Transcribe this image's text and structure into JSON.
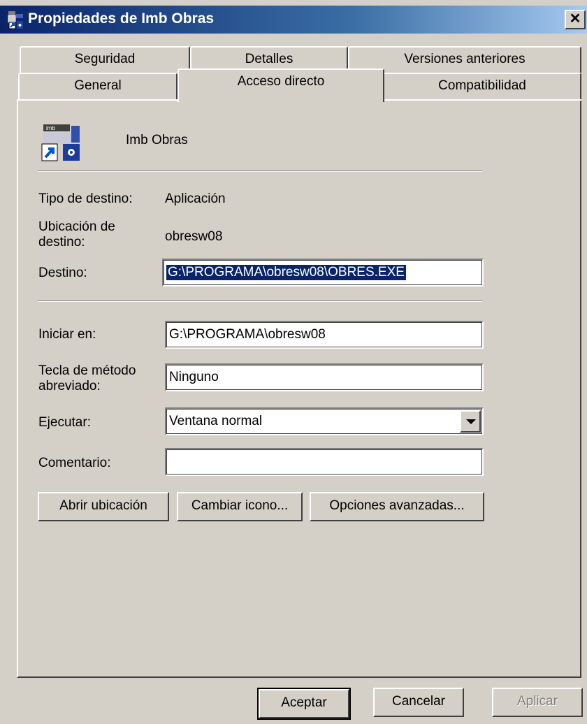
{
  "window": {
    "title": "Propiedades de Imb Obras"
  },
  "tabs_back": [
    {
      "label": "Seguridad"
    },
    {
      "label": "Detalles"
    },
    {
      "label": "Versiones anteriores"
    }
  ],
  "tabs_front": [
    {
      "label": "General"
    },
    {
      "label": "Acceso directo",
      "active": true
    },
    {
      "label": "Compatibilidad"
    }
  ],
  "shortcut": {
    "name": "Imb Obras",
    "icon": "imb-obras-shortcut-icon",
    "target_type_label": "Tipo de destino:",
    "target_type_value": "Aplicación",
    "target_location_label_1": "Ubicación de",
    "target_location_label_2": "destino:",
    "target_location_value": "obresw08",
    "target_label": "Destino:",
    "target_value": "G:\\PROGRAMA\\obresw08\\OBRES.EXE",
    "start_in_label": "Iniciar en:",
    "start_in_value": "G:\\PROGRAMA\\obresw08",
    "hotkey_label_1": "Tecla de método",
    "hotkey_label_2": "abreviado:",
    "hotkey_value": "Ninguno",
    "run_label": "Ejecutar:",
    "run_value": "Ventana normal",
    "comment_label": "Comentario:",
    "comment_value": ""
  },
  "panel_buttons": {
    "open_location": "Abrir ubicación",
    "change_icon": "Cambiar icono...",
    "advanced": "Opciones avanzadas..."
  },
  "dialog_buttons": {
    "ok": "Aceptar",
    "cancel": "Cancelar",
    "apply": "Aplicar",
    "apply_enabled": false
  },
  "colors": {
    "selection": "#0a246a",
    "face": "#d4d0c8"
  }
}
